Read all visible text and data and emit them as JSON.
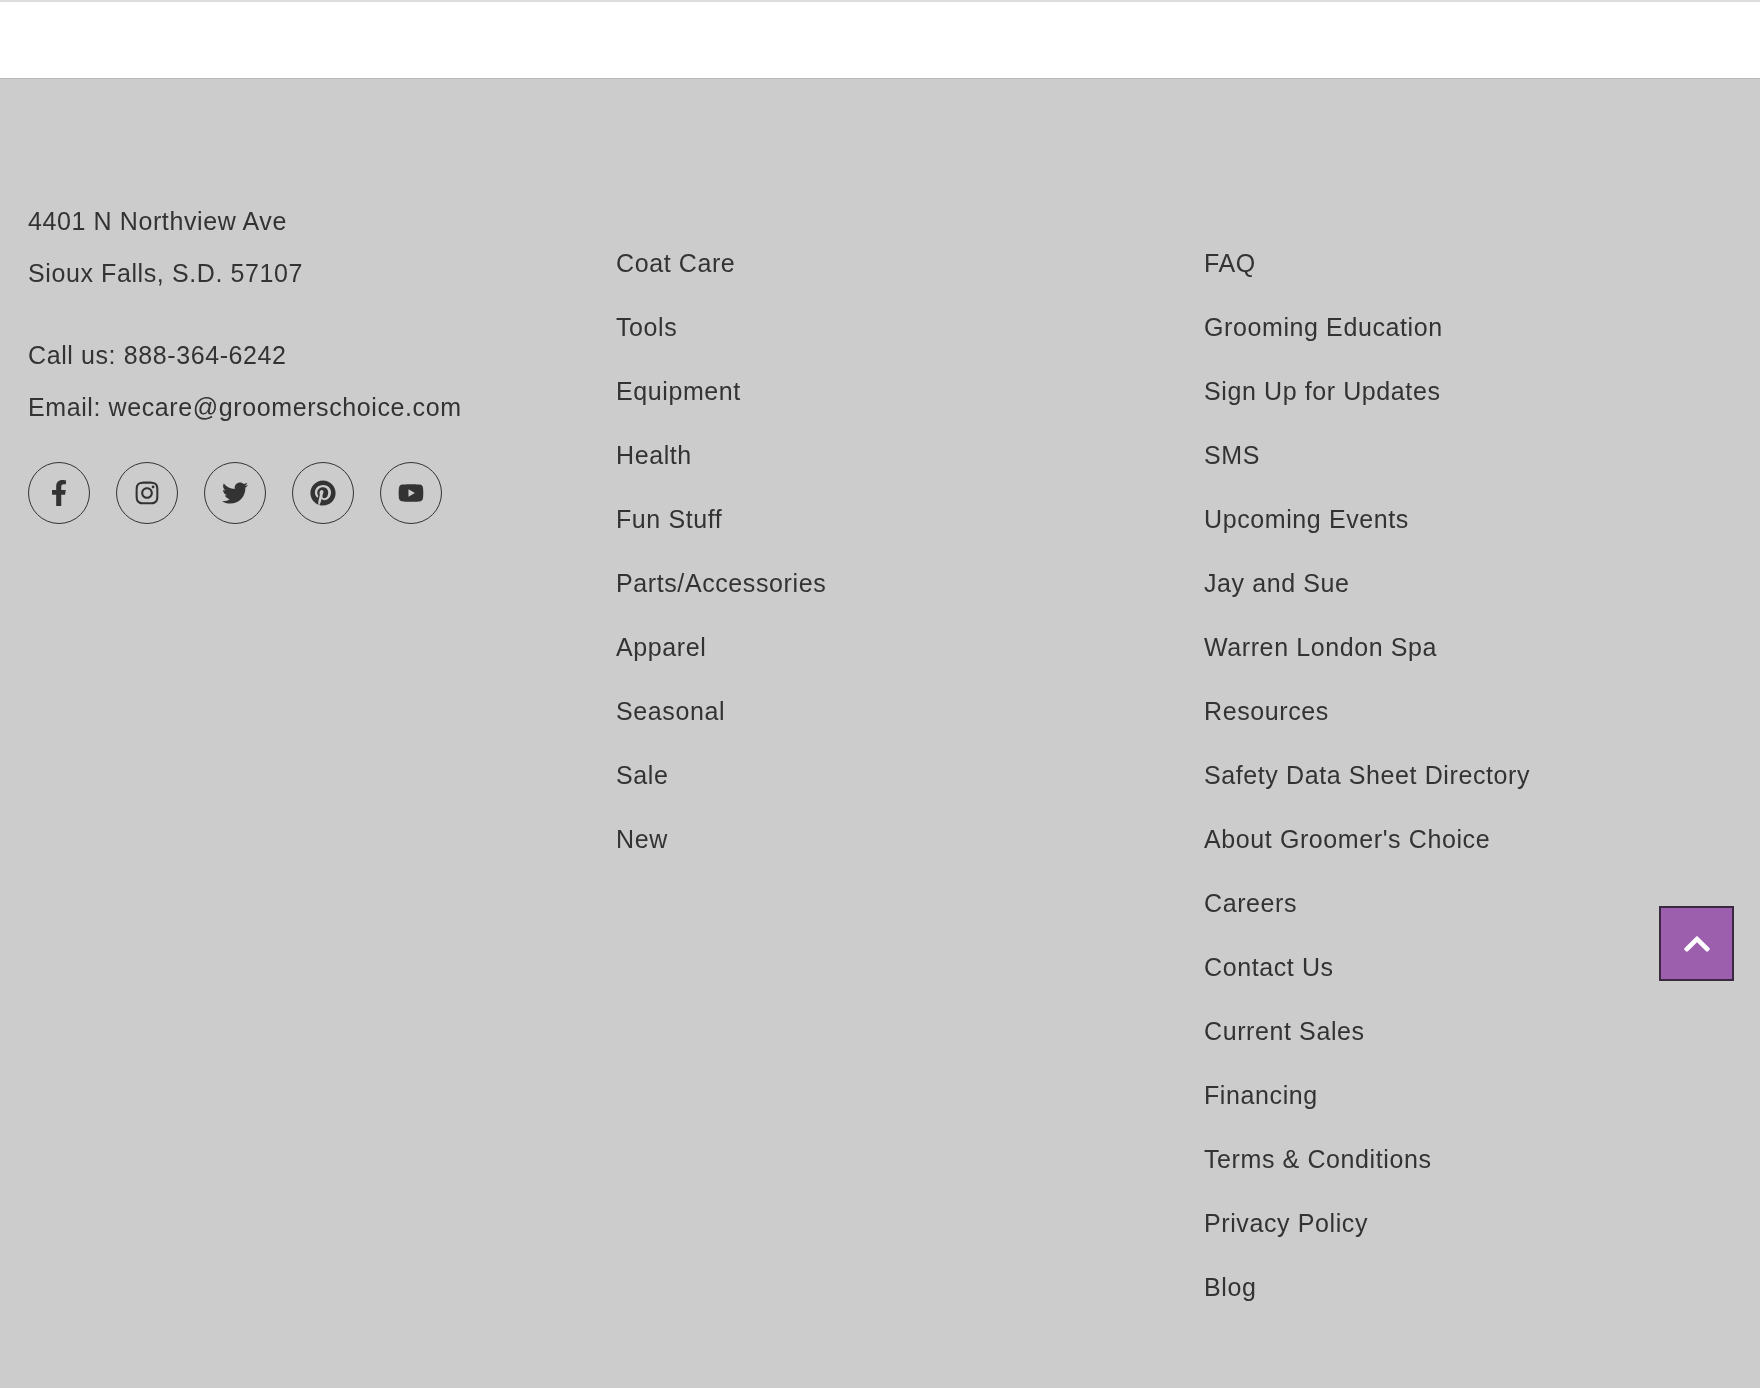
{
  "address": [
    "4401 N Northview Ave",
    "Sioux Falls, S.D. 57107"
  ],
  "contact": [
    "Call us: 888-364-6242",
    "Email: wecare@groomerschoice.com"
  ],
  "social": [
    {
      "kind": "facebook"
    },
    {
      "kind": "instagram"
    },
    {
      "kind": "twitter"
    },
    {
      "kind": "pinterest"
    },
    {
      "kind": "youtube"
    }
  ],
  "link_columns": [
    [
      "Coat Care",
      "Tools",
      "Equipment",
      "Health",
      "Fun Stuff",
      "Parts/Accessories",
      "Apparel",
      "Seasonal",
      "Sale",
      "New"
    ],
    [
      "FAQ",
      "Grooming Education",
      "Sign Up for Updates",
      "SMS",
      "Upcoming Events",
      "Jay and Sue",
      "Warren London Spa",
      "Resources",
      "Safety Data Sheet Directory",
      "About Groomer's Choice",
      "Careers",
      "Contact Us",
      "Current Sales",
      "Financing",
      "Terms & Conditions",
      "Privacy Policy",
      "Blog"
    ]
  ]
}
